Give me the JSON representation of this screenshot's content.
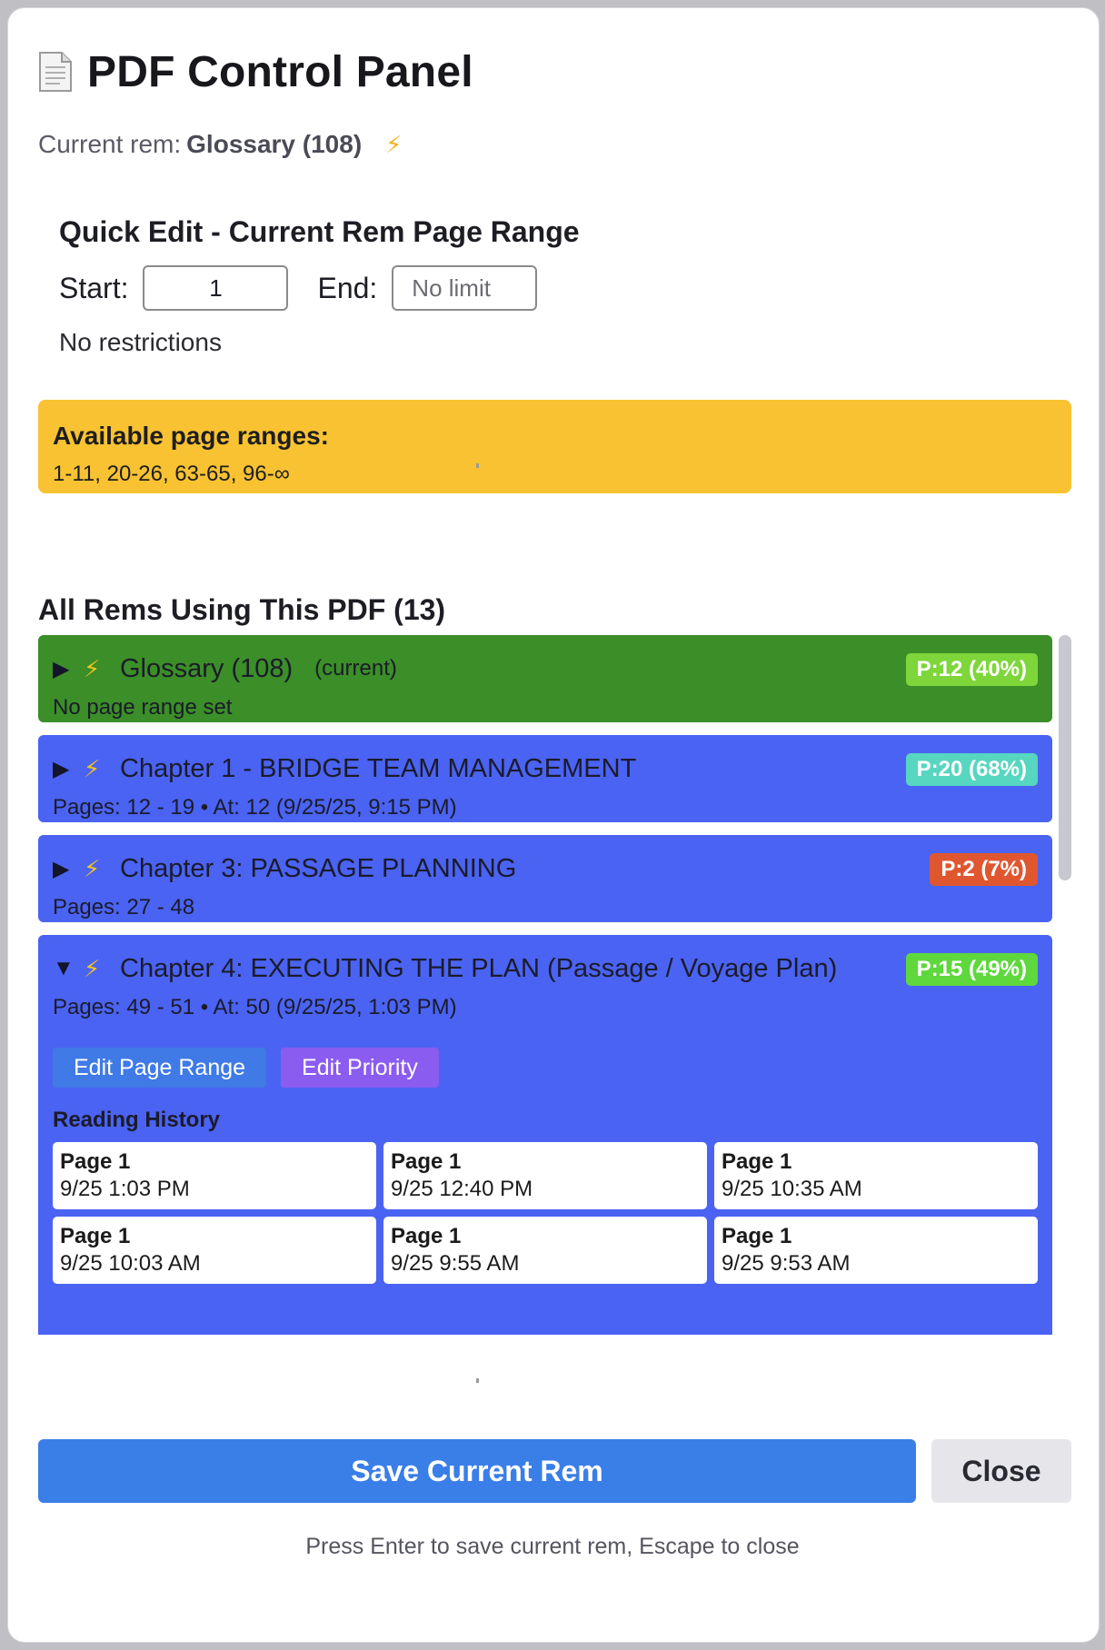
{
  "panel": {
    "title": "PDF Control Panel",
    "icon": "document-icon",
    "current_rem_label": "Current rem:",
    "current_rem_value": "Glossary (108)",
    "current_rem_icon": "⚡"
  },
  "quick_edit": {
    "title": "Quick Edit - Current Rem Page Range",
    "start_label": "Start:",
    "start_value": "1",
    "end_label": "End:",
    "end_placeholder": "No limit",
    "status": "No restrictions"
  },
  "available_ranges": {
    "title": "Available page ranges:",
    "value": "1-11, 20-26, 63-65, 96-∞"
  },
  "rems": {
    "title": "All Rems Using This PDF (13)",
    "items": [
      {
        "name": "Glossary (108)",
        "tag": "(current)",
        "sub": "No page range set",
        "badge": "P:12 (40%)",
        "expanded": false,
        "bg": "#3b8e28",
        "badge_color": "#7ed63a"
      },
      {
        "name": "Chapter 1 - BRIDGE TEAM MANAGEMENT",
        "sub": "Pages: 12 - 19 • At: 12 (9/25/25, 9:15 PM)",
        "badge": "P:20 (68%)",
        "expanded": false,
        "bg": "#4a63f2",
        "badge_color": "#57d6c0"
      },
      {
        "name": "Chapter 3: PASSAGE PLANNING",
        "sub": "Pages: 27 - 48",
        "badge": "P:2 (7%)",
        "expanded": false,
        "bg": "#4a63f2",
        "badge_color": "#e0562f"
      },
      {
        "name": "Chapter 4: EXECUTING THE PLAN (Passage / Voyage Plan)",
        "sub": "Pages: 49 - 51 • At: 50 (9/25/25, 1:03 PM)",
        "badge": "P:15 (49%)",
        "expanded": true,
        "bg": "#4a63f2",
        "badge_color": "#5ed83c",
        "edit_range_label": "Edit Page Range",
        "edit_priority_label": "Edit Priority",
        "history_title": "Reading History",
        "history": [
          {
            "page": "Page 1",
            "time": "9/25 1:03 PM"
          },
          {
            "page": "Page 1",
            "time": "9/25 12:40 PM"
          },
          {
            "page": "Page 1",
            "time": "9/25 10:35 AM"
          },
          {
            "page": "Page 1",
            "time": "9/25 10:03 AM"
          },
          {
            "page": "Page 1",
            "time": "9/25 9:55 AM"
          },
          {
            "page": "Page 1",
            "time": "9/25 9:53 AM"
          }
        ]
      }
    ]
  },
  "actions": {
    "save_label": "Save Current Rem",
    "close_label": "Close",
    "hint": "Press Enter to save current rem, Escape to close"
  },
  "colors": {
    "save": "#3a7ee8",
    "edit_range": "#3f7ae6",
    "edit_priority": "#8b5cf0",
    "ranges_bg": "#f8c232"
  },
  "glyphs": {
    "collapsed": "▶",
    "expanded": "▼",
    "bolt": "⚡"
  }
}
